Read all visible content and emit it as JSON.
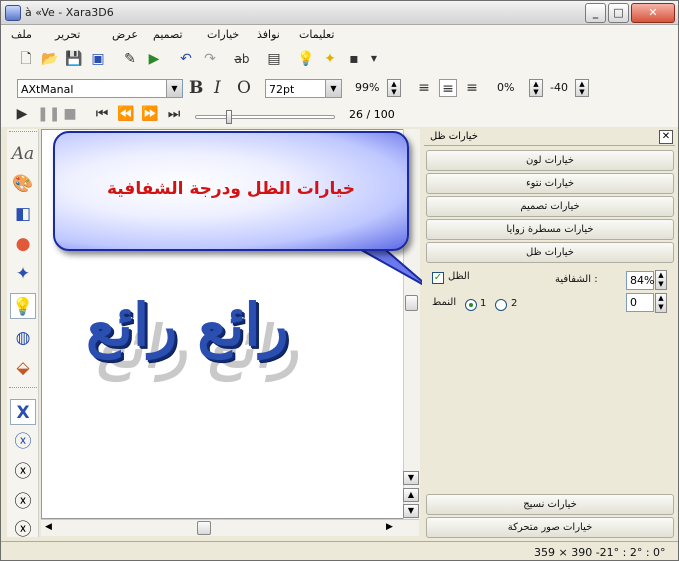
{
  "window": {
    "title": "à «Ve - Xara3D6"
  },
  "menu": [
    "ملف",
    "تحرير",
    "عرض",
    "تصميم",
    "خيارات",
    "نوافذ",
    "تعليمات"
  ],
  "toolbar": {
    "font": "AXtManal",
    "size": "72pt",
    "bold": "B",
    "italic": "I",
    "outline": "O",
    "zoom": "99%",
    "spacing": "0%",
    "angle": "-40",
    "frames": "26 / 100"
  },
  "callout": {
    "text": "خيارات الظل ودرجة الشفافية"
  },
  "canvas": {
    "art_text": "رائع رائع"
  },
  "panel": {
    "title": "خيارات ظل",
    "tabs": [
      "خيارات لون",
      "خيارات نتوء",
      "خيارات تصميم",
      "خيارات مسطرة زوايا",
      "خيارات ظل"
    ],
    "shadow_label": "الظل",
    "transparency_label": "الشفافية :",
    "transparency_value": "84%",
    "style_label": "النمط",
    "radio1": "1",
    "radio2": "2",
    "offset_value": "0",
    "bottom_tabs": [
      "خيارات نسيج",
      "خيارات صور متحركة"
    ]
  },
  "status": {
    "text": "359 × 390  -21° : 2° : 0°"
  }
}
